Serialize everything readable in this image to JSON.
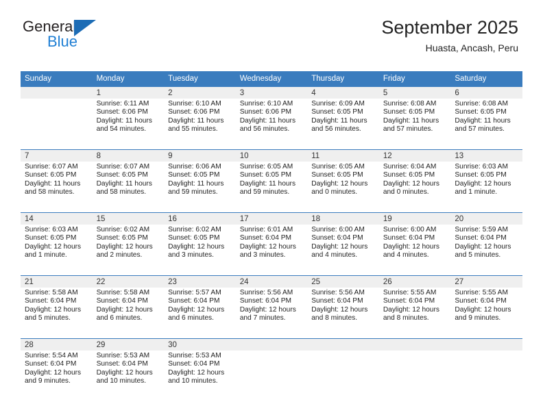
{
  "brand": {
    "name_part1": "General",
    "name_part2": "Blue",
    "accent_color": "#1f7fd4",
    "triangle_color": "#1c6cb5"
  },
  "header": {
    "title": "September 2025",
    "subtitle": "Huasta, Ancash, Peru",
    "header_bg_color": "#3a7cbe",
    "daynum_bg_color": "#efefef"
  },
  "weekdays": [
    "Sunday",
    "Monday",
    "Tuesday",
    "Wednesday",
    "Thursday",
    "Friday",
    "Saturday"
  ],
  "labels": {
    "sunrise_prefix": "Sunrise:",
    "sunset_prefix": "Sunset:",
    "daylight_prefix": "Daylight:"
  },
  "weeks": [
    {
      "days": [
        {
          "num": "",
          "sunrise": "",
          "sunset": "",
          "daylight_a": "",
          "daylight_b": ""
        },
        {
          "num": "1",
          "sunrise": "Sunrise: 6:11 AM",
          "sunset": "Sunset: 6:06 PM",
          "daylight_a": "Daylight: 11 hours",
          "daylight_b": "and 54 minutes."
        },
        {
          "num": "2",
          "sunrise": "Sunrise: 6:10 AM",
          "sunset": "Sunset: 6:06 PM",
          "daylight_a": "Daylight: 11 hours",
          "daylight_b": "and 55 minutes."
        },
        {
          "num": "3",
          "sunrise": "Sunrise: 6:10 AM",
          "sunset": "Sunset: 6:06 PM",
          "daylight_a": "Daylight: 11 hours",
          "daylight_b": "and 56 minutes."
        },
        {
          "num": "4",
          "sunrise": "Sunrise: 6:09 AM",
          "sunset": "Sunset: 6:05 PM",
          "daylight_a": "Daylight: 11 hours",
          "daylight_b": "and 56 minutes."
        },
        {
          "num": "5",
          "sunrise": "Sunrise: 6:08 AM",
          "sunset": "Sunset: 6:05 PM",
          "daylight_a": "Daylight: 11 hours",
          "daylight_b": "and 57 minutes."
        },
        {
          "num": "6",
          "sunrise": "Sunrise: 6:08 AM",
          "sunset": "Sunset: 6:05 PM",
          "daylight_a": "Daylight: 11 hours",
          "daylight_b": "and 57 minutes."
        }
      ]
    },
    {
      "days": [
        {
          "num": "7",
          "sunrise": "Sunrise: 6:07 AM",
          "sunset": "Sunset: 6:05 PM",
          "daylight_a": "Daylight: 11 hours",
          "daylight_b": "and 58 minutes."
        },
        {
          "num": "8",
          "sunrise": "Sunrise: 6:07 AM",
          "sunset": "Sunset: 6:05 PM",
          "daylight_a": "Daylight: 11 hours",
          "daylight_b": "and 58 minutes."
        },
        {
          "num": "9",
          "sunrise": "Sunrise: 6:06 AM",
          "sunset": "Sunset: 6:05 PM",
          "daylight_a": "Daylight: 11 hours",
          "daylight_b": "and 59 minutes."
        },
        {
          "num": "10",
          "sunrise": "Sunrise: 6:05 AM",
          "sunset": "Sunset: 6:05 PM",
          "daylight_a": "Daylight: 11 hours",
          "daylight_b": "and 59 minutes."
        },
        {
          "num": "11",
          "sunrise": "Sunrise: 6:05 AM",
          "sunset": "Sunset: 6:05 PM",
          "daylight_a": "Daylight: 12 hours",
          "daylight_b": "and 0 minutes."
        },
        {
          "num": "12",
          "sunrise": "Sunrise: 6:04 AM",
          "sunset": "Sunset: 6:05 PM",
          "daylight_a": "Daylight: 12 hours",
          "daylight_b": "and 0 minutes."
        },
        {
          "num": "13",
          "sunrise": "Sunrise: 6:03 AM",
          "sunset": "Sunset: 6:05 PM",
          "daylight_a": "Daylight: 12 hours",
          "daylight_b": "and 1 minute."
        }
      ]
    },
    {
      "days": [
        {
          "num": "14",
          "sunrise": "Sunrise: 6:03 AM",
          "sunset": "Sunset: 6:05 PM",
          "daylight_a": "Daylight: 12 hours",
          "daylight_b": "and 1 minute."
        },
        {
          "num": "15",
          "sunrise": "Sunrise: 6:02 AM",
          "sunset": "Sunset: 6:05 PM",
          "daylight_a": "Daylight: 12 hours",
          "daylight_b": "and 2 minutes."
        },
        {
          "num": "16",
          "sunrise": "Sunrise: 6:02 AM",
          "sunset": "Sunset: 6:05 PM",
          "daylight_a": "Daylight: 12 hours",
          "daylight_b": "and 3 minutes."
        },
        {
          "num": "17",
          "sunrise": "Sunrise: 6:01 AM",
          "sunset": "Sunset: 6:04 PM",
          "daylight_a": "Daylight: 12 hours",
          "daylight_b": "and 3 minutes."
        },
        {
          "num": "18",
          "sunrise": "Sunrise: 6:00 AM",
          "sunset": "Sunset: 6:04 PM",
          "daylight_a": "Daylight: 12 hours",
          "daylight_b": "and 4 minutes."
        },
        {
          "num": "19",
          "sunrise": "Sunrise: 6:00 AM",
          "sunset": "Sunset: 6:04 PM",
          "daylight_a": "Daylight: 12 hours",
          "daylight_b": "and 4 minutes."
        },
        {
          "num": "20",
          "sunrise": "Sunrise: 5:59 AM",
          "sunset": "Sunset: 6:04 PM",
          "daylight_a": "Daylight: 12 hours",
          "daylight_b": "and 5 minutes."
        }
      ]
    },
    {
      "days": [
        {
          "num": "21",
          "sunrise": "Sunrise: 5:58 AM",
          "sunset": "Sunset: 6:04 PM",
          "daylight_a": "Daylight: 12 hours",
          "daylight_b": "and 5 minutes."
        },
        {
          "num": "22",
          "sunrise": "Sunrise: 5:58 AM",
          "sunset": "Sunset: 6:04 PM",
          "daylight_a": "Daylight: 12 hours",
          "daylight_b": "and 6 minutes."
        },
        {
          "num": "23",
          "sunrise": "Sunrise: 5:57 AM",
          "sunset": "Sunset: 6:04 PM",
          "daylight_a": "Daylight: 12 hours",
          "daylight_b": "and 6 minutes."
        },
        {
          "num": "24",
          "sunrise": "Sunrise: 5:56 AM",
          "sunset": "Sunset: 6:04 PM",
          "daylight_a": "Daylight: 12 hours",
          "daylight_b": "and 7 minutes."
        },
        {
          "num": "25",
          "sunrise": "Sunrise: 5:56 AM",
          "sunset": "Sunset: 6:04 PM",
          "daylight_a": "Daylight: 12 hours",
          "daylight_b": "and 8 minutes."
        },
        {
          "num": "26",
          "sunrise": "Sunrise: 5:55 AM",
          "sunset": "Sunset: 6:04 PM",
          "daylight_a": "Daylight: 12 hours",
          "daylight_b": "and 8 minutes."
        },
        {
          "num": "27",
          "sunrise": "Sunrise: 5:55 AM",
          "sunset": "Sunset: 6:04 PM",
          "daylight_a": "Daylight: 12 hours",
          "daylight_b": "and 9 minutes."
        }
      ]
    },
    {
      "days": [
        {
          "num": "28",
          "sunrise": "Sunrise: 5:54 AM",
          "sunset": "Sunset: 6:04 PM",
          "daylight_a": "Daylight: 12 hours",
          "daylight_b": "and 9 minutes."
        },
        {
          "num": "29",
          "sunrise": "Sunrise: 5:53 AM",
          "sunset": "Sunset: 6:04 PM",
          "daylight_a": "Daylight: 12 hours",
          "daylight_b": "and 10 minutes."
        },
        {
          "num": "30",
          "sunrise": "Sunrise: 5:53 AM",
          "sunset": "Sunset: 6:04 PM",
          "daylight_a": "Daylight: 12 hours",
          "daylight_b": "and 10 minutes."
        },
        {
          "num": "",
          "sunrise": "",
          "sunset": "",
          "daylight_a": "",
          "daylight_b": ""
        },
        {
          "num": "",
          "sunrise": "",
          "sunset": "",
          "daylight_a": "",
          "daylight_b": ""
        },
        {
          "num": "",
          "sunrise": "",
          "sunset": "",
          "daylight_a": "",
          "daylight_b": ""
        },
        {
          "num": "",
          "sunrise": "",
          "sunset": "",
          "daylight_a": "",
          "daylight_b": ""
        }
      ]
    }
  ]
}
